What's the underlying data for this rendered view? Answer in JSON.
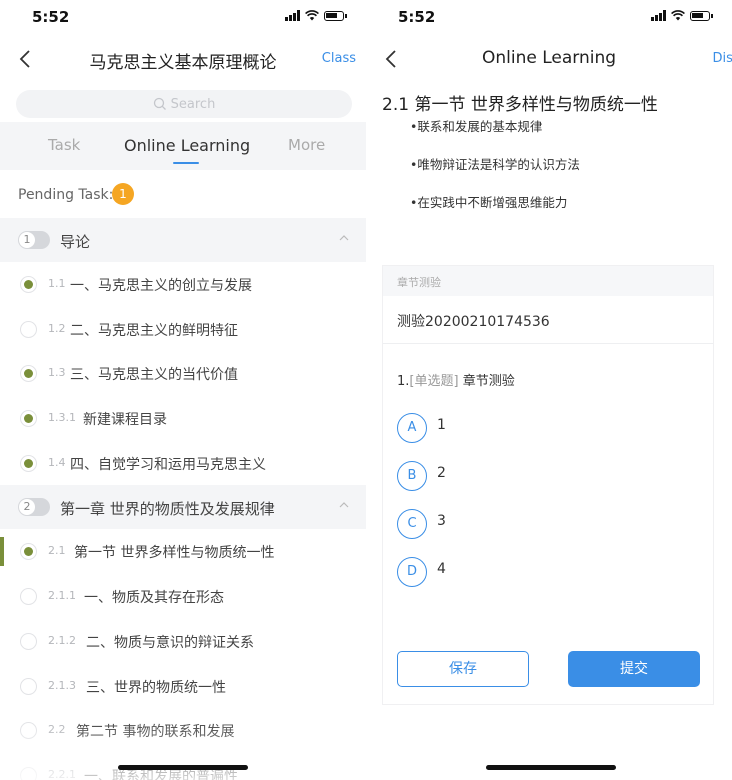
{
  "left": {
    "status_time": "5:52",
    "nav": {
      "title": "马克思主义基本原理概论",
      "right_link": "Class"
    },
    "search_placeholder": "Search",
    "tabs": [
      "Task",
      "Online Learning",
      "More"
    ],
    "pending_label": "Pending Task:",
    "pending_count": "1",
    "chapters": [
      {
        "num": "1",
        "title": "导论"
      },
      {
        "num": "2",
        "title": "第一章  世界的物质性及发展规律"
      }
    ],
    "items": [
      {
        "idx": "1.1",
        "text": "一、马克思主义的创立与发展",
        "done": true
      },
      {
        "idx": "1.2",
        "text": "二、马克思主义的鲜明特征",
        "done": false
      },
      {
        "idx": "1.3",
        "text": "三、马克思主义的当代价值",
        "done": true
      },
      {
        "idx": "1.3.1",
        "text": "新建课程目录",
        "done": true
      },
      {
        "idx": "1.4",
        "text": "四、自觉学习和运用马克思主义",
        "done": true
      },
      {
        "idx": "2.1",
        "text": "第一节  世界多样性与物质统一性",
        "done": true
      },
      {
        "idx": "2.1.1",
        "text": "一、物质及其存在形态",
        "done": false
      },
      {
        "idx": "2.1.2",
        "text": "二、物质与意识的辩证关系",
        "done": false
      },
      {
        "idx": "2.1.3",
        "text": "三、世界的物质统一性",
        "done": false
      },
      {
        "idx": "2.2",
        "text": "第二节  事物的联系和发展",
        "done": false
      },
      {
        "idx": "2.2.1",
        "text": "一、联系和发展的普遍性",
        "done": false
      }
    ]
  },
  "right": {
    "status_time": "5:52",
    "nav": {
      "title": "Online Learning",
      "right_link": "Disc"
    },
    "section_title": "2.1 第一节  世界多样性与物质统一性",
    "bullets": [
      "•联系和发展的基本规律",
      "•唯物辩证法是科学的认识方法",
      "•在实践中不断增强思维能力"
    ],
    "quiz": {
      "header": "章节测验",
      "name": "测验20200210174536",
      "question_num": "1.",
      "question_type": "[单选题]",
      "question_text": " 章节测验",
      "options": [
        {
          "letter": "A",
          "value": "1"
        },
        {
          "letter": "B",
          "value": "2"
        },
        {
          "letter": "C",
          "value": "3"
        },
        {
          "letter": "D",
          "value": "4"
        }
      ],
      "save_label": "保存",
      "submit_label": "提交"
    }
  },
  "colors": {
    "accent": "#3a8ee6",
    "done": "#7a8f3a",
    "badge": "#f5a623"
  }
}
